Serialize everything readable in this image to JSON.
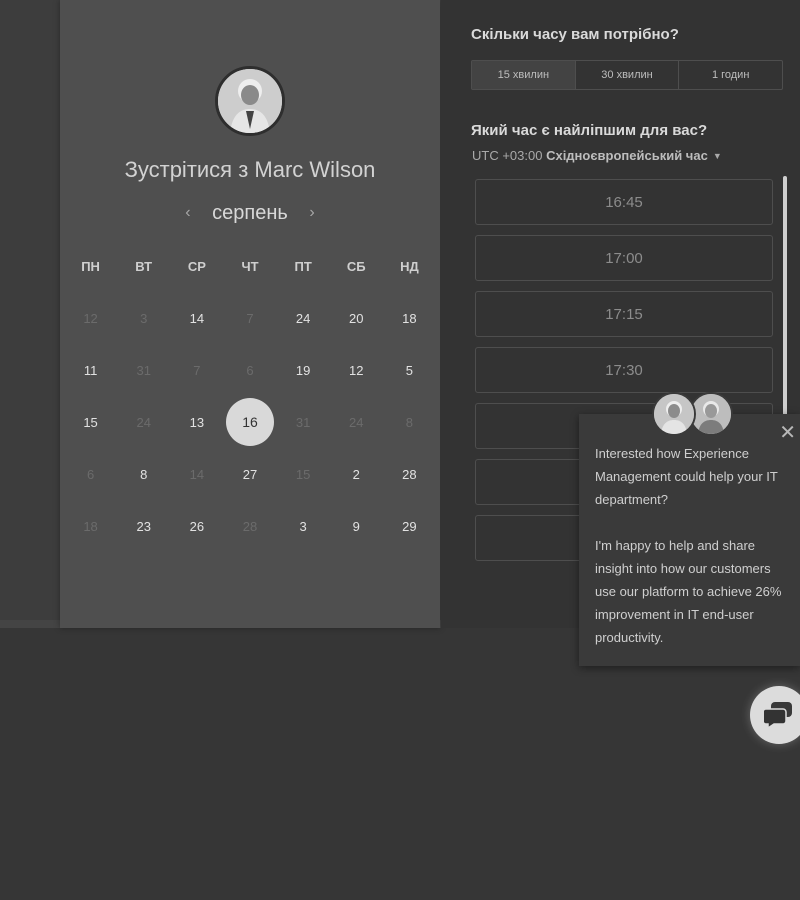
{
  "host": {
    "title": "Зустрітися з Marc Wilson"
  },
  "calendar": {
    "month": "серпень",
    "weekdays": [
      "ПН",
      "ВТ",
      "СР",
      "ЧТ",
      "ПТ",
      "СБ",
      "НД"
    ],
    "rows": [
      [
        {
          "d": "12",
          "on": false
        },
        {
          "d": "3",
          "on": false
        },
        {
          "d": "14",
          "on": true
        },
        {
          "d": "7",
          "on": false
        },
        {
          "d": "24",
          "on": true
        },
        {
          "d": "20",
          "on": true
        },
        {
          "d": "18",
          "on": true
        }
      ],
      [
        {
          "d": "11",
          "on": true
        },
        {
          "d": "31",
          "on": false
        },
        {
          "d": "7",
          "on": false
        },
        {
          "d": "6",
          "on": false
        },
        {
          "d": "19",
          "on": true
        },
        {
          "d": "12",
          "on": true
        },
        {
          "d": "5",
          "on": true
        }
      ],
      [
        {
          "d": "15",
          "on": true
        },
        {
          "d": "24",
          "on": false
        },
        {
          "d": "13",
          "on": true
        },
        {
          "d": "16",
          "on": true,
          "sel": true
        },
        {
          "d": "31",
          "on": false
        },
        {
          "d": "24",
          "on": false
        },
        {
          "d": "8",
          "on": false
        }
      ],
      [
        {
          "d": "6",
          "on": false
        },
        {
          "d": "8",
          "on": true
        },
        {
          "d": "14",
          "on": false
        },
        {
          "d": "27",
          "on": true
        },
        {
          "d": "15",
          "on": false
        },
        {
          "d": "2",
          "on": true
        },
        {
          "d": "28",
          "on": true
        }
      ],
      [
        {
          "d": "18",
          "on": false
        },
        {
          "d": "23",
          "on": true
        },
        {
          "d": "26",
          "on": true
        },
        {
          "d": "28",
          "on": false
        },
        {
          "d": "3",
          "on": true
        },
        {
          "d": "9",
          "on": true
        },
        {
          "d": "29",
          "on": true
        }
      ]
    ]
  },
  "duration": {
    "question": "Скільки часу вам потрібно?",
    "options": [
      "15 хвилин",
      "30 хвилин",
      "1 годин"
    ],
    "selected": 0
  },
  "times": {
    "question": "Який час є найліпшим для вас?",
    "tz_prefix": "UTC +03:00",
    "tz_name": "Східноєвропейський час",
    "slots": [
      "16:45",
      "17:00",
      "17:15",
      "17:30",
      "",
      "",
      ""
    ]
  },
  "chat": {
    "messages": [
      "Interested how Experience Management could help your IT department?",
      "I'm happy to help and share insight into how our customers use our platform to achieve 26% improvement in IT end-user productivity."
    ]
  },
  "colors": {
    "background": "#363636",
    "panel": "#4f4f4f",
    "selected_day": "#d9d9d9"
  }
}
